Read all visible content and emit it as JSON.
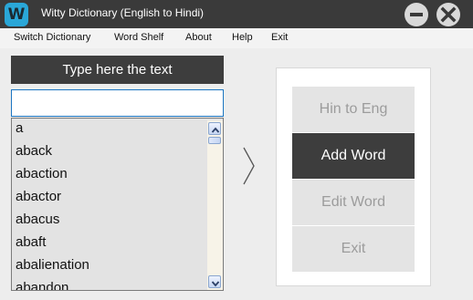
{
  "window": {
    "title": "Witty Dictionary (English to Hindi)",
    "icon_letter": "W",
    "accent": "#2aa7d8",
    "minimize_icon": "minus-icon",
    "close_icon": "close-icon"
  },
  "menu": {
    "items": [
      "Switch Dictionary",
      "Word Shelf",
      "About",
      "Help",
      "Exit"
    ]
  },
  "search": {
    "header": "Type here the text",
    "value": "",
    "placeholder": ""
  },
  "word_list": {
    "items": [
      "a",
      "aback",
      "abaction",
      "abactor",
      "abacus",
      "abaft",
      "abalienation",
      "abandon"
    ]
  },
  "actions": {
    "items": [
      {
        "label": "Hin to Eng",
        "active": false
      },
      {
        "label": "Add Word",
        "active": true
      },
      {
        "label": "Edit Word",
        "active": false
      },
      {
        "label": "Exit",
        "active": false
      }
    ]
  },
  "colors": {
    "titlebar": "#3a3a3a",
    "active_button": "#3d3d3d",
    "inactive_button": "#e4e4e4"
  }
}
